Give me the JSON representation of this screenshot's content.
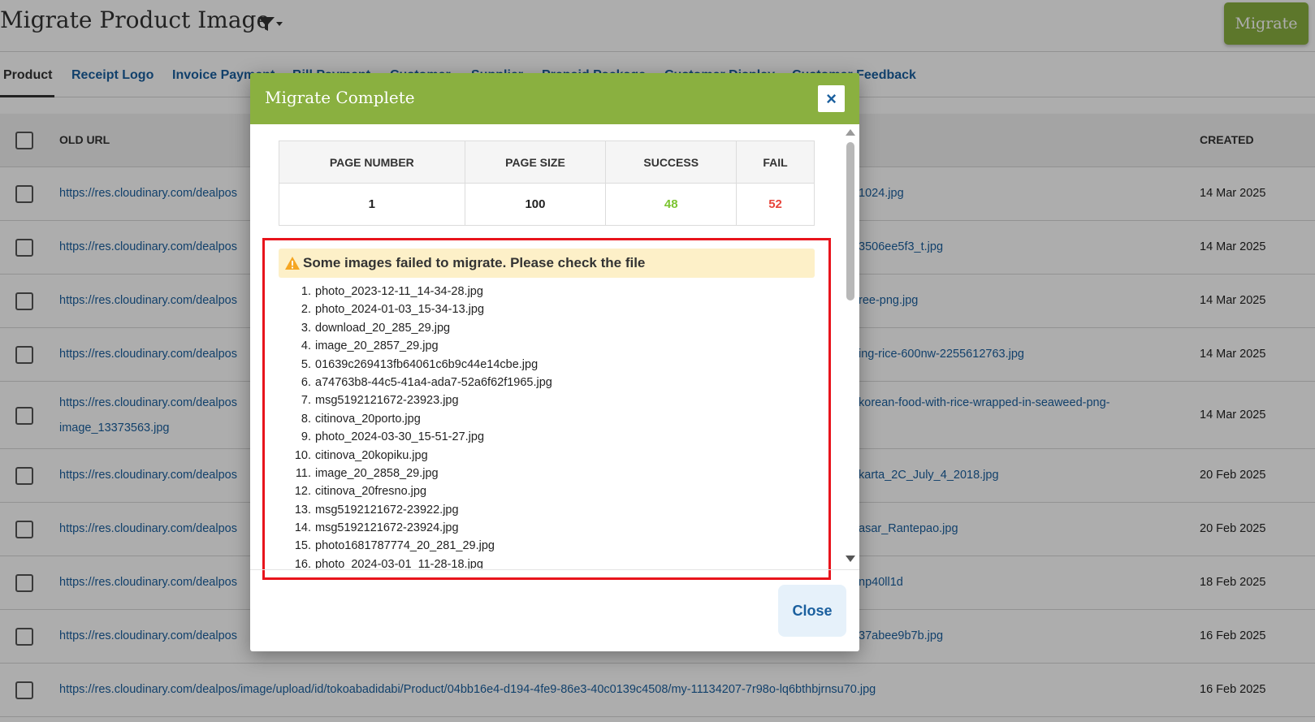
{
  "page": {
    "title": "Migrate Product Image",
    "migrate_label": "Migrate",
    "tabs": [
      {
        "label": "Product",
        "active": true
      },
      {
        "label": "Receipt Logo"
      },
      {
        "label": "Invoice Payment"
      },
      {
        "label": "Bill Payment"
      },
      {
        "label": "Customer"
      },
      {
        "label": "Supplier"
      },
      {
        "label": "Prepaid Package"
      },
      {
        "label": "Customer Display"
      },
      {
        "label": "Customer Feedback"
      }
    ],
    "table": {
      "col_old_url": "OLD URL",
      "col_created": "CREATED",
      "rows": [
        {
          "url": "https://res.cloudinary.com/dealpos",
          "url_right": "1024.jpg",
          "created": "14 Mar 2025"
        },
        {
          "url": "https://res.cloudinary.com/dealpos",
          "url_right": "3506ee5f3_t.jpg",
          "created": "14 Mar 2025"
        },
        {
          "url": "https://res.cloudinary.com/dealpos",
          "url_right": "ree-png.jpg",
          "created": "14 Mar 2025"
        },
        {
          "url": "https://res.cloudinary.com/dealpos",
          "url_right": "ing-rice-600nw-2255612763.jpg",
          "created": "14 Mar 2025"
        },
        {
          "url": "https://res.cloudinary.com/dealpos",
          "url_line2": "image_13373563.jpg",
          "url_right": "korean-food-with-rice-wrapped-in-seaweed-png-",
          "created": "14 Mar 2025"
        },
        {
          "url": "https://res.cloudinary.com/dealpos",
          "url_right": "karta_2C_July_4_2018.jpg",
          "created": "20 Feb 2025"
        },
        {
          "url": "https://res.cloudinary.com/dealpos",
          "url_right": "asar_Rantepao.jpg",
          "created": "20 Feb 2025"
        },
        {
          "url": "https://res.cloudinary.com/dealpos",
          "url_right": "np40ll1d",
          "created": "18 Feb 2025"
        },
        {
          "url": "https://res.cloudinary.com/dealpos",
          "url_right": "37abee9b7b.jpg",
          "created": "16 Feb 2025"
        },
        {
          "url": "https://res.cloudinary.com/dealpos/image/upload/id/tokoabadidabi/Product/04bb16e4-d194-4fe9-86e3-40c0139c4508/my-11134207-7r98o-lq6bthbjrnsu70.jpg",
          "created": "16 Feb 2025"
        }
      ]
    }
  },
  "modal": {
    "title": "Migrate Complete",
    "close_x": "×",
    "stats_headers": [
      "PAGE NUMBER",
      "PAGE SIZE",
      "SUCCESS",
      "FAIL"
    ],
    "stats_values": [
      "1",
      "100",
      "48",
      "52"
    ],
    "warning_text": "Some images failed to migrate. Please check the file",
    "failed_files": [
      "photo_2023-12-11_14-34-28.jpg",
      "photo_2024-01-03_15-34-13.jpg",
      "download_20_285_29.jpg",
      "image_20_2857_29.jpg",
      "01639c269413fb64061c6b9c44e14cbe.jpg",
      "a74763b8-44c5-41a4-ada7-52a6f62f1965.jpg",
      "msg5192121672-23923.jpg",
      "citinova_20porto.jpg",
      "photo_2024-03-30_15-51-27.jpg",
      "citinova_20kopiku.jpg",
      "image_20_2858_29.jpg",
      "citinova_20fresno.jpg",
      "msg5192121672-23922.jpg",
      "msg5192121672-23924.jpg",
      "photo1681787774_20_281_29.jpg",
      "photo_2024-03-01_11-28-18.jpg"
    ],
    "close_label": "Close"
  },
  "colors": {
    "accent_green": "#8ab040",
    "link_blue": "#1a5f9e",
    "success_green": "#7cc431",
    "fail_red": "#e8453c",
    "highlight_red": "#e8141c",
    "warning_bg": "#fdf0c8"
  },
  "icons": [
    "filter-icon",
    "warning-icon",
    "close-icon"
  ]
}
